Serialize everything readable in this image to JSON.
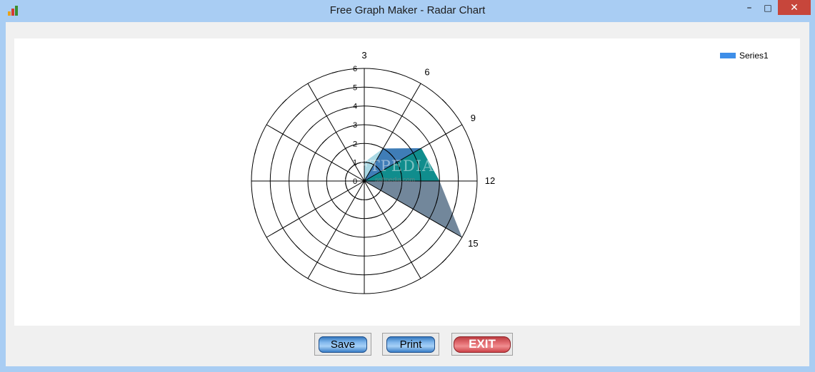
{
  "window": {
    "title": "Free Graph Maker - Radar Chart",
    "min_glyph": "–",
    "max_glyph": "□",
    "close_glyph": "✕"
  },
  "buttons": {
    "save": "Save",
    "print": "Print",
    "exit": "EXIT"
  },
  "watermark": {
    "text": "FTPEDIA",
    "url": "softpedia.com"
  },
  "colors": {
    "legend_swatch": "#3e8ee8",
    "area_light": "#a9d8e4",
    "area_blue": "#3f7db7",
    "area_teal": "#108d8d",
    "area_slate": "#72879b"
  },
  "chart_data": {
    "type": "radar",
    "legend": [
      "Series1"
    ],
    "legend_position": "top-right",
    "angle_labels": [
      "3",
      "6",
      "9",
      "12",
      "15"
    ],
    "radial_ticks": [
      "0",
      "1",
      "2",
      "3",
      "4",
      "5",
      "6"
    ],
    "rlim": [
      0,
      6
    ],
    "grid": true,
    "series": [
      {
        "name": "Series1",
        "points": [
          {
            "x": "3",
            "value": 1
          },
          {
            "x": "6",
            "value": 2
          },
          {
            "x": "9",
            "value": 3.5
          },
          {
            "x": "12",
            "value": 4
          },
          {
            "x": "15",
            "value": 6
          }
        ]
      }
    ]
  }
}
